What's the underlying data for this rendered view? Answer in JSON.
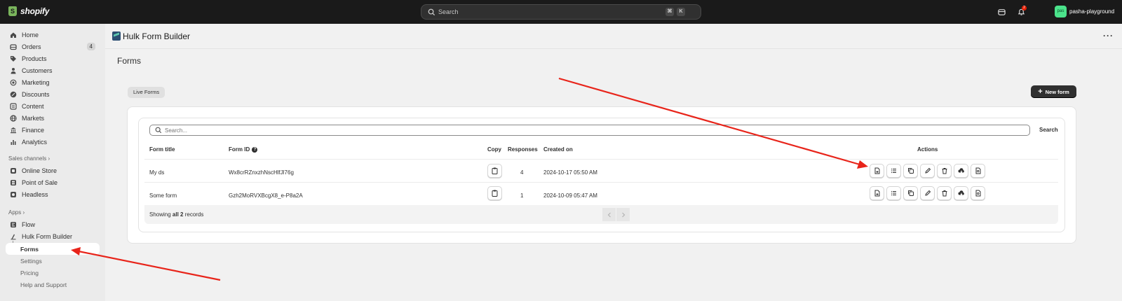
{
  "topbar": {
    "brand": "shopify",
    "search_placeholder": "Search",
    "shortcut_keys": [
      "⌘",
      "K"
    ],
    "notification_count": "2",
    "user_initials": "pas",
    "store_name": "pasha-playground"
  },
  "sidebar": {
    "items": [
      {
        "label": "Home",
        "icon": "home-icon"
      },
      {
        "label": "Orders",
        "icon": "orders-icon",
        "badge": "4"
      },
      {
        "label": "Products",
        "icon": "tag-icon"
      },
      {
        "label": "Customers",
        "icon": "person-icon"
      },
      {
        "label": "Marketing",
        "icon": "target-icon"
      },
      {
        "label": "Discounts",
        "icon": "discount-icon"
      },
      {
        "label": "Content",
        "icon": "content-icon"
      },
      {
        "label": "Markets",
        "icon": "globe-icon"
      },
      {
        "label": "Finance",
        "icon": "bank-icon"
      },
      {
        "label": "Analytics",
        "icon": "chart-icon"
      }
    ],
    "sales_channels_label": "Sales channels",
    "channels": [
      {
        "label": "Online Store",
        "icon": "store-icon"
      },
      {
        "label": "Point of Sale",
        "icon": "pos-icon"
      },
      {
        "label": "Headless",
        "icon": "headless-icon"
      }
    ],
    "apps_label": "Apps",
    "apps": [
      {
        "label": "Flow",
        "icon": "flow-icon"
      },
      {
        "label": "Hulk Form Builder",
        "icon": "hulk-icon"
      }
    ],
    "app_subitems": [
      "Forms",
      "Settings",
      "Pricing",
      "Help and Support"
    ]
  },
  "app": {
    "title": "Hulk Form Builder",
    "page_title": "Forms",
    "live_forms_tab": "Live Forms",
    "new_form_label": "New form",
    "search_placeholder": "Search...",
    "search_button": "Search"
  },
  "table": {
    "headers": {
      "title": "Form title",
      "form_id": "Form ID",
      "copy": "Copy",
      "responses": "Responses",
      "created": "Created on",
      "actions": "Actions"
    },
    "rows": [
      {
        "title": "My ds",
        "form_id": "Wx8crRZnxzhNscHlfJl76g",
        "responses": "4",
        "created": "2024-10-17 05:50 AM"
      },
      {
        "title": "Some form",
        "form_id": "Gzh2MoRVXBcgX8_e-P8a2A",
        "responses": "1",
        "created": "2024-10-09 05:47 AM"
      }
    ],
    "footer": {
      "prefix": "Showing ",
      "count": "all 2",
      "suffix": " records"
    }
  },
  "colors": {
    "topbar": "#1a1a1a",
    "sidebar": "#ebebeb",
    "primary_button": "#303030",
    "annotation_arrow": "#e8241a"
  }
}
